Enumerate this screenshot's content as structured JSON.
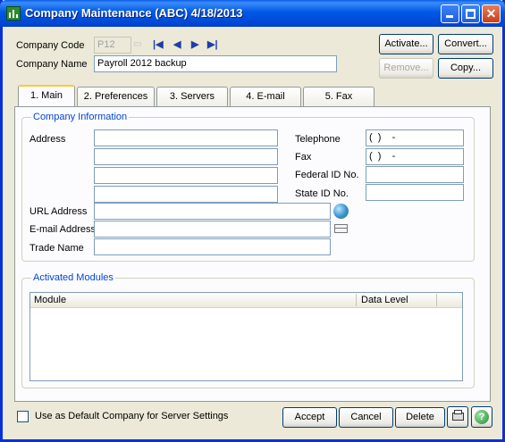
{
  "window": {
    "title": "Company Maintenance (ABC) 4/18/2013"
  },
  "header": {
    "company_code_label": "Company Code",
    "company_code_value": "P12",
    "company_name_label": "Company Name",
    "company_name_value": "Payroll 2012 backup",
    "buttons": {
      "activate": "Activate...",
      "convert": "Convert...",
      "remove": "Remove...",
      "copy": "Copy..."
    }
  },
  "tabs": [
    {
      "label": "1. Main"
    },
    {
      "label": "2. Preferences"
    },
    {
      "label": "3. Servers"
    },
    {
      "label": "4. E-mail"
    },
    {
      "label": "5. Fax"
    }
  ],
  "company_info": {
    "group_title": "Company Information",
    "address_label": "Address",
    "address_lines": [
      "",
      "",
      "",
      ""
    ],
    "telephone_label": "Telephone",
    "telephone_value": "(  )    -",
    "fax_label": "Fax",
    "fax_value": "(  )    -",
    "federal_id_label": "Federal ID No.",
    "federal_id_value": "",
    "state_id_label": "State ID No.",
    "state_id_value": "",
    "url_label": "URL Address",
    "url_value": "",
    "email_label": "E-mail Address",
    "email_value": "",
    "trade_name_label": "Trade Name",
    "trade_name_value": ""
  },
  "activated_modules": {
    "group_title": "Activated Modules",
    "columns": [
      "Module",
      "Data Level"
    ],
    "rows": []
  },
  "footer": {
    "default_company_label": "Use as Default Company for Server Settings",
    "default_company_checked": false,
    "accept": "Accept",
    "cancel": "Cancel",
    "delete": "Delete"
  },
  "icons": {
    "app": "company-icon",
    "first": "first-record-icon",
    "prev": "previous-record-icon",
    "next": "next-record-icon",
    "last": "last-record-icon",
    "globe": "globe-icon",
    "mail": "envelope-icon",
    "print": "printer-icon",
    "help": "help-icon"
  },
  "colors": {
    "title_bar": "#0058e6",
    "group_title": "#0046d5",
    "tab_highlight": "#ffc83c"
  }
}
